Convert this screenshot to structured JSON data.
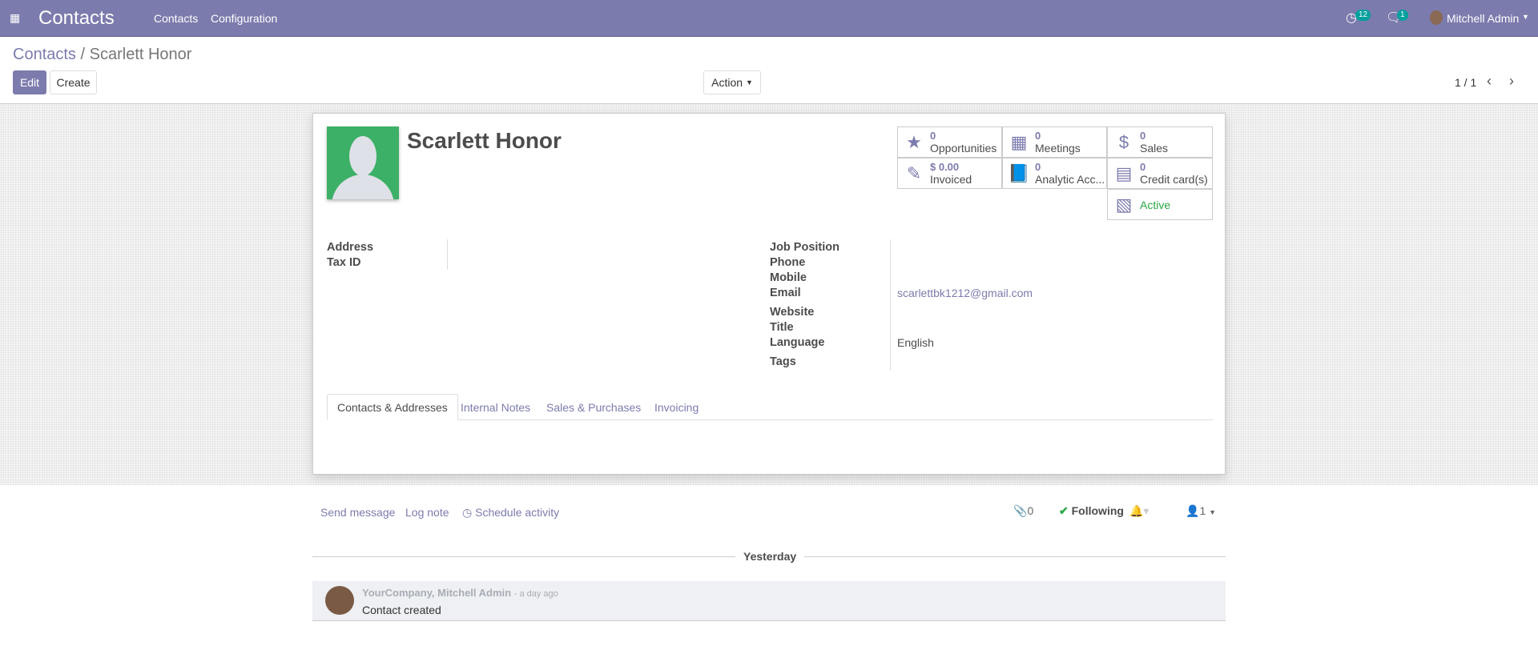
{
  "navbar": {
    "app_title": "Contacts",
    "menu": [
      "Contacts",
      "Configuration"
    ],
    "activity_count": "12",
    "message_count": "1",
    "user": "Mitchell Admin",
    "color": "#7c7bad"
  },
  "breadcrumb": {
    "parent": "Contacts",
    "separator": "/",
    "current": "Scarlett Honor"
  },
  "toolbar": {
    "edit": "Edit",
    "create": "Create",
    "action": "Action",
    "pager": "1 / 1"
  },
  "record": {
    "name": "Scarlett Honor",
    "smart_buttons": [
      {
        "icon": "star-icon",
        "value": "0",
        "label": "Opportunities"
      },
      {
        "icon": "calendar-icon",
        "value": "0",
        "label": "Meetings"
      },
      {
        "icon": "dollar-icon",
        "value": "0",
        "label": "Sales"
      },
      {
        "icon": "edit-icon",
        "value": "$ 0.00",
        "label": "Invoiced"
      },
      {
        "icon": "book-icon",
        "value": "0",
        "label": "Analytic Acc..."
      },
      {
        "icon": "credit-card-icon",
        "value": "0",
        "label": "Credit card(s)"
      },
      {
        "icon": "archive-icon",
        "value": "",
        "label": "Active"
      }
    ],
    "left_fields": [
      {
        "label": "Address",
        "value": ""
      },
      {
        "label": "Tax ID",
        "value": ""
      }
    ],
    "right_fields": [
      {
        "label": "Job Position",
        "value": ""
      },
      {
        "label": "Phone",
        "value": ""
      },
      {
        "label": "Mobile",
        "value": ""
      },
      {
        "label": "Email",
        "value": "scarlettbk1212@gmail.com"
      },
      {
        "label": "Website",
        "value": ""
      },
      {
        "label": "Title",
        "value": ""
      },
      {
        "label": "Language",
        "value": "English"
      },
      {
        "label": "Tags",
        "value": ""
      }
    ],
    "tabs": [
      "Contacts & Addresses",
      "Internal Notes",
      "Sales & Purchases",
      "Invoicing"
    ],
    "active_tab": "Contacts & Addresses"
  },
  "chatter": {
    "send_message": "Send message",
    "log_note": "Log note",
    "schedule_activity": "Schedule activity",
    "attachments": "0",
    "following": "Following",
    "followers": "1",
    "date_separator": "Yesterday",
    "messages": [
      {
        "author": "YourCompany, Mitchell Admin",
        "time": "- a day ago",
        "body": "Contact created"
      }
    ]
  }
}
